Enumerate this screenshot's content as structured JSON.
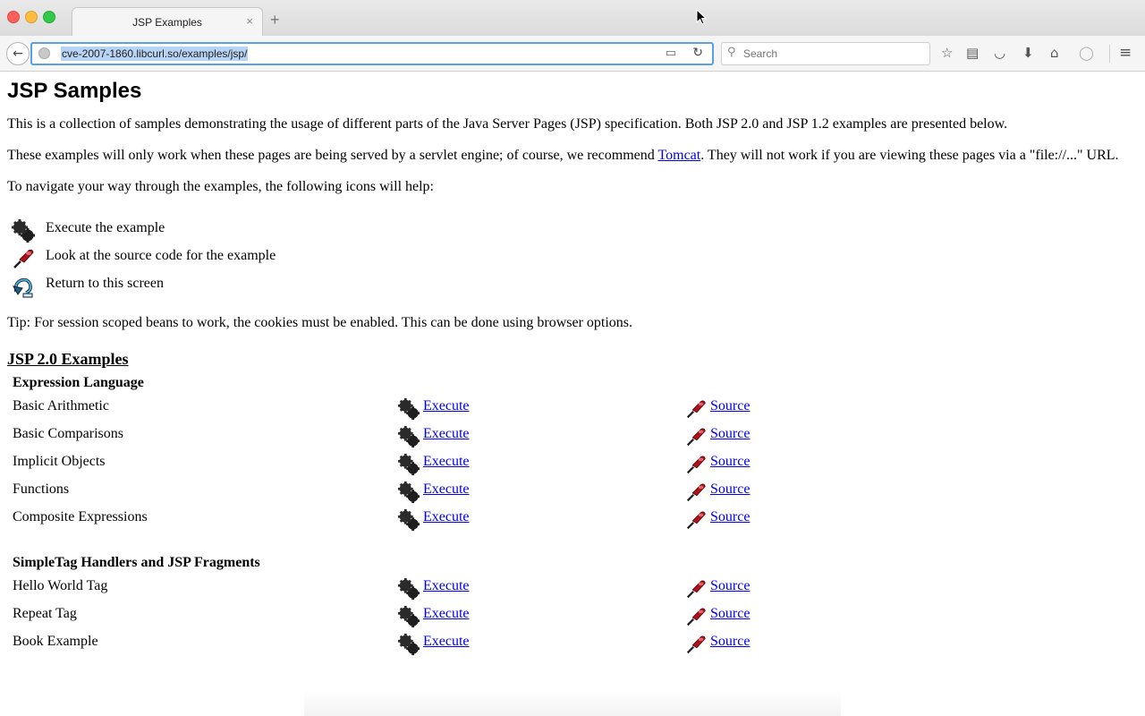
{
  "browser": {
    "tab_title": "JSP Examples",
    "tab_close": "×",
    "new_tab": "+",
    "url": "cve-2007-1860.libcurl.so/examples/jsp/",
    "search_placeholder": "Search"
  },
  "page": {
    "title": "JSP Samples",
    "intro": "This is a collection of samples demonstrating the usage of different parts of the Java Server Pages (JSP) specification. Both JSP 2.0 and JSP 1.2 examples are presented below.",
    "note_before": "These examples will only work when these pages are being served by a servlet engine; of course, we recommend ",
    "note_link": "Tomcat",
    "note_after": ". They will not work if you are viewing these pages via a \"file://...\" URL.",
    "navigate": "To navigate your way through the examples, the following icons will help:",
    "legend": [
      {
        "icon": "gears-icon",
        "text": "Execute the example"
      },
      {
        "icon": "pen-icon",
        "text": "Look at the source code for the example"
      },
      {
        "icon": "return-icon",
        "text": "Return to this screen"
      }
    ],
    "tip": "Tip: For session scoped beans to work, the cookies must be enabled. This can be done using browser options.",
    "section_title": "JSP 2.0 Examples",
    "groups": [
      {
        "title": "Expression Language",
        "rows": [
          {
            "name": "Basic Arithmetic",
            "execute": "Execute",
            "source": "Source"
          },
          {
            "name": "Basic Comparisons",
            "execute": "Execute",
            "source": "Source"
          },
          {
            "name": "Implicit Objects",
            "execute": "Execute",
            "source": "Source"
          },
          {
            "name": "Functions",
            "execute": "Execute",
            "source": "Source"
          },
          {
            "name": "Composite Expressions",
            "execute": "Execute",
            "source": "Source"
          }
        ]
      },
      {
        "title": "SimpleTag Handlers and JSP Fragments",
        "rows": [
          {
            "name": "Hello World Tag",
            "execute": "Execute",
            "source": "Source"
          },
          {
            "name": "Repeat Tag",
            "execute": "Execute",
            "source": "Source"
          },
          {
            "name": "Book Example",
            "execute": "Execute",
            "source": "Source"
          }
        ]
      }
    ]
  }
}
